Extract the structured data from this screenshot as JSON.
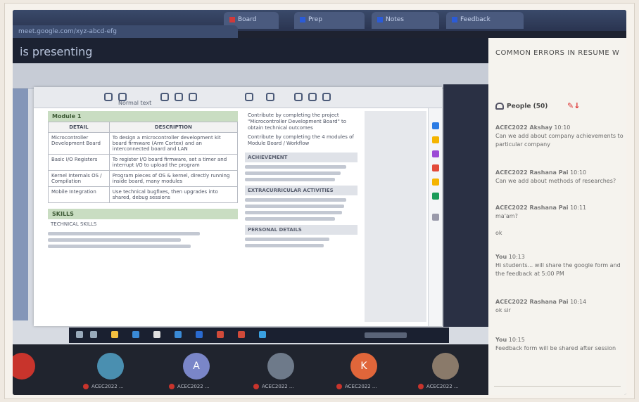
{
  "browser": {
    "tabs": [
      "Board",
      "Prep",
      "Notes",
      "Feedback"
    ],
    "url": "meet.google.com/xyz-abcd-efg"
  },
  "meeting": {
    "presenting_label": "is presenting"
  },
  "document": {
    "toolbar_label": "Normal text",
    "section_heading": "Module 1",
    "table_headers": [
      "DETAIL",
      "DESCRIPTION"
    ],
    "table_rows": [
      {
        "detail": "Microcontroller Development Board",
        "desc": "To design a microcontroller development kit board firmware (Arm Cortex) and an interconnected board and LAN"
      },
      {
        "detail": "Basic I/O Registers",
        "desc": "To register I/O board firmware, set a timer and interrupt I/O to upload the program"
      },
      {
        "detail": "Kernel Internals OS / Compilation",
        "desc": "Program pieces of OS & kernel, directly running inside board, many modules"
      },
      {
        "detail": "Mobile Integration",
        "desc": "Use technical bugfixes, then upgrades into shared, debug sessions"
      }
    ],
    "section_2": "SKILLS",
    "skills_line": "TECHNICAL SKILLS",
    "right_col_items": [
      "Contribute by completing the project \"Microcontroller Development Board\" to obtain technical outcomes",
      "Contribute by completing the 4 modules of Module Board / Workflow"
    ],
    "right_head_1": "ACHIEVEMENT",
    "right_head_2": "EXTRACURRICULAR ACTIVITIES",
    "right_head_3": "PERSONAL DETAILS"
  },
  "chat": {
    "title": "COMMON ERRORS IN RESUME W",
    "people_label": "People (50)",
    "messages": [
      {
        "who": "ACEC2022 Akshay",
        "time": "10:10",
        "text": "Can we add about company achievements to particular company"
      },
      {
        "who": "ACEC2022 Rashana Pai",
        "time": "10:10",
        "text": "Can we add about methods of researches?"
      },
      {
        "who": "ACEC2022 Rashana Pai",
        "time": "10:11",
        "text": "ma'am?"
      },
      {
        "who": "",
        "time": "",
        "text": "ok"
      },
      {
        "who": "You",
        "time": "10:13",
        "text": "Hi students... will share the google form and the feedback at 5:00 PM"
      },
      {
        "who": "ACEC2022 Rashana Pai",
        "time": "10:14",
        "text": "ok sir"
      },
      {
        "who": "You",
        "time": "10:15",
        "text": "Feedback form will be shared after session"
      }
    ]
  },
  "participants": [
    {
      "initial": "",
      "name": "",
      "color": "#c8342c"
    },
    {
      "initial": "",
      "name": "ACEC2022 ...",
      "color": "#4a8fb0"
    },
    {
      "initial": "A",
      "name": "ACEC2022 ...",
      "color": "#7a86c8"
    },
    {
      "initial": "",
      "name": "ACEC2022 ...",
      "color": "#6e7a8a"
    },
    {
      "initial": "K",
      "name": "ACEC2022 ...",
      "color": "#e0663a"
    },
    {
      "initial": "",
      "name": "ACEC2022 ...",
      "color": "#8a7a6a"
    }
  ]
}
